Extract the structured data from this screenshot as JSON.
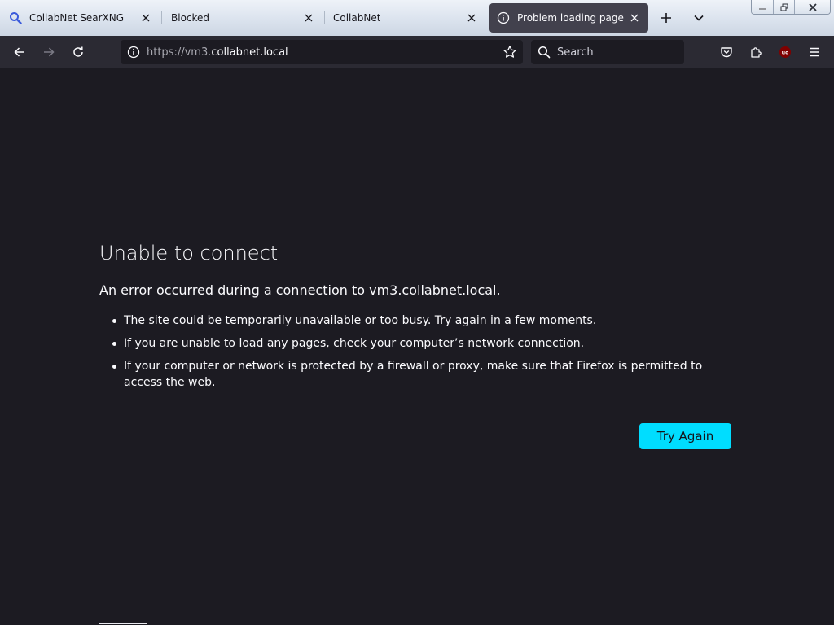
{
  "tabs": [
    {
      "label": "CollabNet SearXNG",
      "icon": "search-icon",
      "active": false
    },
    {
      "label": "Blocked",
      "icon": "",
      "active": false
    },
    {
      "label": "CollabNet",
      "icon": "",
      "active": false
    },
    {
      "label": "Problem loading page",
      "icon": "info-icon",
      "active": true
    }
  ],
  "navbar": {
    "url_prefix": "https://vm3.",
    "url_domain": "collabnet.local",
    "search_placeholder": "Search"
  },
  "error_page": {
    "title": "Unable to connect",
    "description": "An error occurred during a connection to vm3.collabnet.local.",
    "bullets": [
      "The site could be temporarily unavailable or too busy. Try again in a few moments.",
      "If you are unable to load any pages, check your computer’s network connection.",
      "If your computer or network is protected by a firewall or proxy, make sure that Firefox is permitted to access the web."
    ],
    "try_again_label": "Try Again"
  },
  "colors": {
    "page_background": "#1c1b22",
    "toolbar": "#2b2a33",
    "accent_button": "#00ddff",
    "active_tab": "#42414d"
  }
}
